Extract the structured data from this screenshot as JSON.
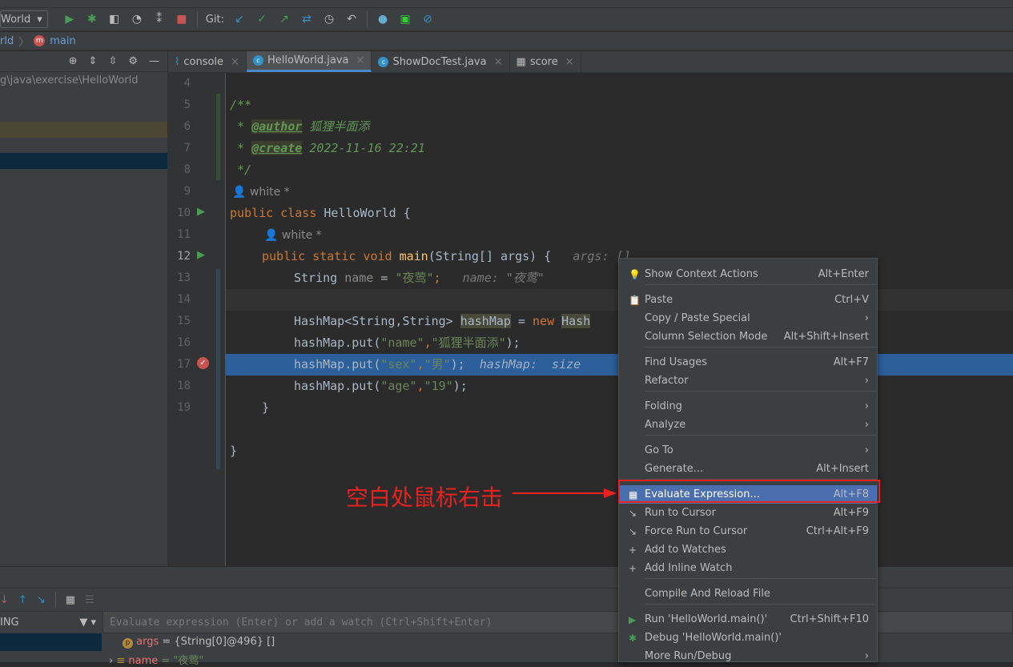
{
  "toolbar": {
    "config": "World",
    "git_label": "Git:"
  },
  "breadcrumb": {
    "class": "rld",
    "method": "main"
  },
  "left_panel": {
    "path": "g\\java\\exercise\\HelloWorld"
  },
  "tabs": [
    {
      "label": "console"
    },
    {
      "label": "HelloWorld.java"
    },
    {
      "label": "ShowDocTest.java"
    },
    {
      "label": "score"
    }
  ],
  "editor": {
    "line_numbers": [
      "4",
      "5",
      "6",
      "7",
      "8",
      "9",
      "10",
      "11",
      "12",
      "13",
      "14",
      "15",
      "16",
      "17",
      "18",
      "19"
    ],
    "author_hint": "white *",
    "lines": {
      "l5": "/**",
      "l6_tag": "@author",
      "l6_text": " 狐狸半面添",
      "l7_tag": "@create",
      "l7_text": " 2022-11-16 22:21",
      "l8": " */",
      "l9_kw": "public class ",
      "l9_rest": "HelloWorld {",
      "l10_kw": "public static void ",
      "l10_fn": "main",
      "l10_rest": "(String[] args) {",
      "l10_hint": "args: []",
      "l11_a": "String ",
      "l11_var": "name",
      "l11_b": " = ",
      "l11_str": "\"夜莺\"",
      "l11_c": ";",
      "l11_hint": "name: \"夜莺\"",
      "l13_a": "HashMap<String,String> ",
      "l13_var": "hashMap",
      "l13_b": " = ",
      "l13_kw": "new ",
      "l13_c": "Hash",
      "l14_a": "hashMap.put(",
      "l14_s1": "\"name\"",
      "l14_comma": ",",
      "l14_s2": "\"狐狸半面添\"",
      "l14_end": ");",
      "l15_a": "hashMap.put(",
      "l15_s1": "\"sex\"",
      "l15_comma": ",",
      "l15_s2": "\"男\"",
      "l15_end": ");",
      "l15_hint": "hashMap:  size",
      "l16_a": "hashMap.put(",
      "l16_s1": "\"age\"",
      "l16_comma": ",",
      "l16_s2": "\"19\"",
      "l16_end": ");",
      "l17": "}",
      "l19": "}"
    }
  },
  "debug": {
    "frames_label": "ING",
    "watch_placeholder": "Evaluate expression (Enter) or add a watch (Ctrl+Shift+Enter)",
    "vars": [
      {
        "name": "args",
        "value": "= {String[0]@496} []"
      },
      {
        "name": "name",
        "value": "= \"夜莺\""
      }
    ]
  },
  "context_menu": {
    "items": [
      {
        "label": "Show Context Actions",
        "shortcut": "Alt+Enter",
        "icon": "bulb-icon"
      },
      {
        "label": "Paste",
        "shortcut": "Ctrl+V",
        "icon": "clipboard-icon"
      },
      {
        "label": "Copy / Paste Special",
        "shortcut": "›"
      },
      {
        "label": "Column Selection Mode",
        "shortcut": "Alt+Shift+Insert"
      },
      {
        "label": "Find Usages",
        "shortcut": "Alt+F7"
      },
      {
        "label": "Refactor",
        "shortcut": "›"
      },
      {
        "label": "Folding",
        "shortcut": "›"
      },
      {
        "label": "Analyze",
        "shortcut": "›"
      },
      {
        "label": "Go To",
        "shortcut": "›"
      },
      {
        "label": "Generate...",
        "shortcut": "Alt+Insert"
      },
      {
        "label": "Evaluate Expression...",
        "shortcut": "Alt+F8",
        "icon": "calculator-icon"
      },
      {
        "label": "Run to Cursor",
        "shortcut": "Alt+F9",
        "icon": "run-to-cursor-icon"
      },
      {
        "label": "Force Run to Cursor",
        "shortcut": "Ctrl+Alt+F9",
        "icon": "force-run-icon"
      },
      {
        "label": "Add to Watches",
        "shortcut": "",
        "icon": "add-watch-icon"
      },
      {
        "label": "Add Inline Watch",
        "shortcut": "",
        "icon": "add-inline-watch-icon"
      },
      {
        "label": "Compile And Reload File",
        "shortcut": ""
      },
      {
        "label": "Run 'HelloWorld.main()'",
        "shortcut": "Ctrl+Shift+F10",
        "icon": "run-icon"
      },
      {
        "label": "Debug 'HelloWorld.main()'",
        "shortcut": "",
        "icon": "debug-icon"
      },
      {
        "label": "More Run/Debug",
        "shortcut": "›"
      }
    ]
  },
  "annotation": {
    "text": "空白处鼠标右击",
    "color": "#e8231f"
  }
}
